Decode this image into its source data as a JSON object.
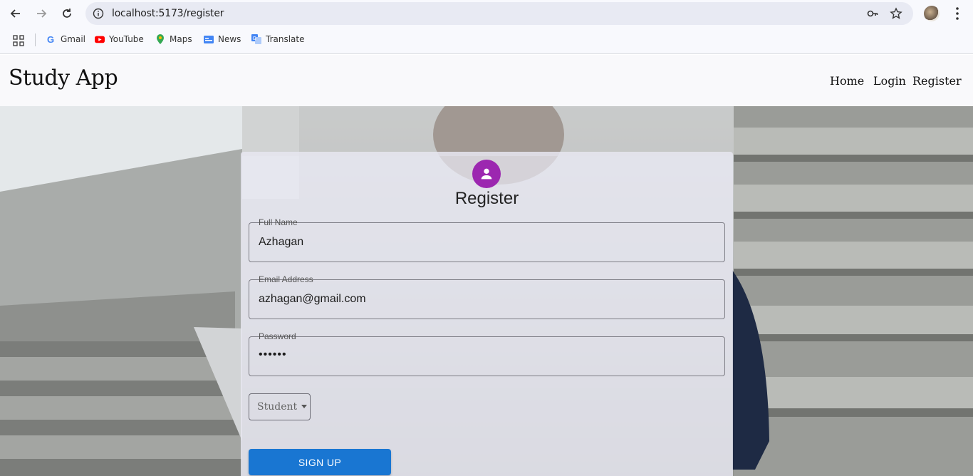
{
  "browser": {
    "url": "localhost:5173/register",
    "bookmarks": [
      {
        "label": "Gmail",
        "icon": "gmail-icon"
      },
      {
        "label": "YouTube",
        "icon": "youtube-icon"
      },
      {
        "label": "Maps",
        "icon": "maps-icon"
      },
      {
        "label": "News",
        "icon": "news-icon"
      },
      {
        "label": "Translate",
        "icon": "translate-icon"
      }
    ]
  },
  "header": {
    "brand": "Study App",
    "nav": [
      "Home",
      "Login",
      "Register"
    ]
  },
  "form": {
    "title": "Register",
    "fields": [
      {
        "label": "Full Name",
        "value": "Azhagan"
      },
      {
        "label": "Email Address",
        "value": "azhagan@gmail.com"
      },
      {
        "label": "Password",
        "value": "••••••"
      }
    ],
    "role": "Student",
    "submit": "SIGN UP"
  },
  "colors": {
    "avatar": "#9c27b0",
    "primary_button": "#1976d2"
  }
}
